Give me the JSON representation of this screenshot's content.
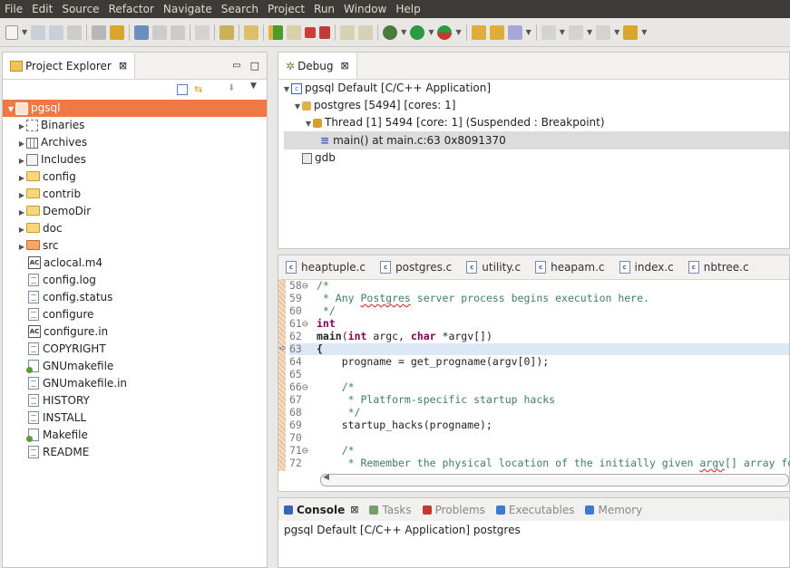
{
  "menu": [
    "File",
    "Edit",
    "Source",
    "Refactor",
    "Navigate",
    "Search",
    "Project",
    "Run",
    "Window",
    "Help"
  ],
  "project_explorer": {
    "title": "Project Explorer",
    "close_glyph": "⊠",
    "items": [
      {
        "label": "pgsql",
        "kind": "project",
        "expanded": true,
        "selected": true
      },
      {
        "label": "Binaries",
        "kind": "binaries"
      },
      {
        "label": "Archives",
        "kind": "archives"
      },
      {
        "label": "Includes",
        "kind": "includes"
      },
      {
        "label": "config",
        "kind": "folder"
      },
      {
        "label": "contrib",
        "kind": "folder"
      },
      {
        "label": "DemoDir",
        "kind": "folder"
      },
      {
        "label": "doc",
        "kind": "folder"
      },
      {
        "label": "src",
        "kind": "srcfolder"
      },
      {
        "label": "aclocal.m4",
        "kind": "ac"
      },
      {
        "label": "config.log",
        "kind": "file"
      },
      {
        "label": "config.status",
        "kind": "file"
      },
      {
        "label": "configure",
        "kind": "file"
      },
      {
        "label": "configure.in",
        "kind": "ac"
      },
      {
        "label": "COPYRIGHT",
        "kind": "file"
      },
      {
        "label": "GNUmakefile",
        "kind": "make"
      },
      {
        "label": "GNUmakefile.in",
        "kind": "file"
      },
      {
        "label": "HISTORY",
        "kind": "file"
      },
      {
        "label": "INSTALL",
        "kind": "file"
      },
      {
        "label": "Makefile",
        "kind": "make"
      },
      {
        "label": "README",
        "kind": "file"
      }
    ]
  },
  "debug": {
    "title": "Debug",
    "close_glyph": "⊠",
    "launch": "pgsql Default [C/C++ Application]",
    "process": "postgres [5494] [cores: 1]",
    "thread": "Thread [1] 5494 [core: 1] (Suspended : Breakpoint)",
    "frame": "main() at main.c:63 0x8091370",
    "gdb": "gdb"
  },
  "editor": {
    "tabs": [
      "heaptuple.c",
      "postgres.c",
      "utility.c",
      "heapam.c",
      "index.c",
      "nbtree.c"
    ],
    "lines": [
      {
        "n": "58",
        "fold": "⊖",
        "html": "<span class=\"cmt\">/*</span>"
      },
      {
        "n": "59",
        "fold": "",
        "html": "<span class=\"cmt\"> * Any <span class=\"ul\">Postgres</span> server process begins execution here.</span>"
      },
      {
        "n": "60",
        "fold": "",
        "html": "<span class=\"cmt\"> */</span>"
      },
      {
        "n": "61",
        "fold": "⊖",
        "html": "<span class=\"kw\">int</span>"
      },
      {
        "n": "62",
        "fold": "",
        "html": "<b>main</b>(<span class=\"kw\">int</span> argc, <span class=\"kw\">char</span> *argv[])"
      },
      {
        "n": "63",
        "fold": "",
        "html": "<b>{</b>",
        "current": true
      },
      {
        "n": "64",
        "fold": "",
        "html": "    progname = get_progname(argv[0]);"
      },
      {
        "n": "65",
        "fold": "",
        "html": ""
      },
      {
        "n": "66",
        "fold": "⊖",
        "html": "    <span class=\"cmt\">/*</span>"
      },
      {
        "n": "67",
        "fold": "",
        "html": "<span class=\"cmt\">     * Platform-specific startup hacks</span>"
      },
      {
        "n": "68",
        "fold": "",
        "html": "<span class=\"cmt\">     */</span>"
      },
      {
        "n": "69",
        "fold": "",
        "html": "    startup_hacks(progname);"
      },
      {
        "n": "70",
        "fold": "",
        "html": ""
      },
      {
        "n": "71",
        "fold": "⊖",
        "html": "    <span class=\"cmt\">/*</span>"
      },
      {
        "n": "72",
        "fold": "",
        "html": "<span class=\"cmt\">     * Remember the physical location of the initially given <span class=\"ul\">argv</span>[] array for</span>"
      }
    ]
  },
  "console": {
    "tabs": [
      "Console",
      "Tasks",
      "Problems",
      "Executables",
      "Memory"
    ],
    "close_glyph": "⊠",
    "status": "pgsql Default [C/C++ Application] postgres"
  },
  "colors": {
    "selection": "#f07746",
    "menubar": "#3c3b37",
    "comment": "#3f7f5f",
    "keyword": "#7f0055"
  }
}
